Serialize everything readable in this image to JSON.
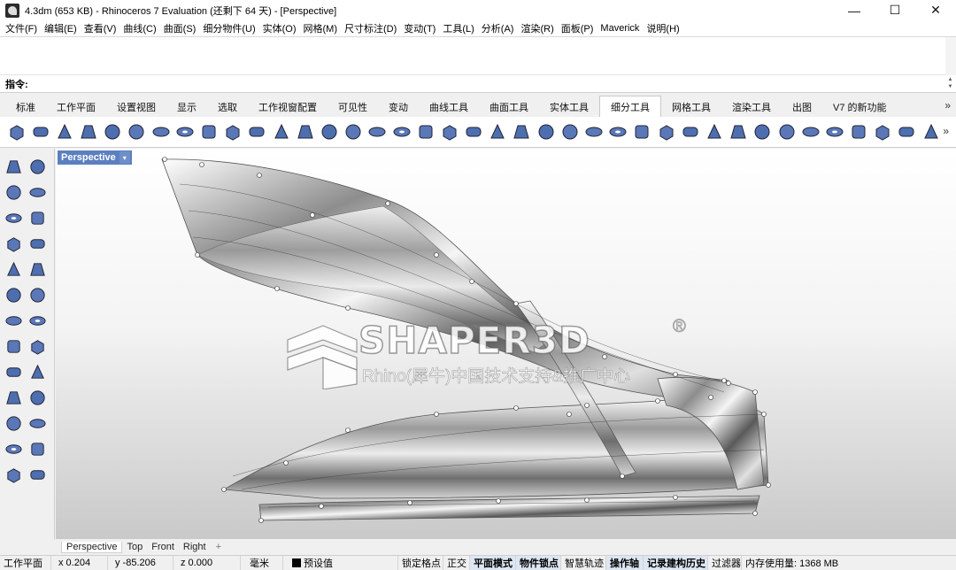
{
  "window": {
    "title": "4.3dm (653 KB) - Rhinoceros 7 Evaluation (还剩下 64 天) - [Perspective]",
    "minimize_glyph": "—",
    "maximize_glyph": "☐",
    "close_glyph": "✕"
  },
  "menu": [
    "文件(F)",
    "编辑(E)",
    "查看(V)",
    "曲线(C)",
    "曲面(S)",
    "细分物件(U)",
    "实体(O)",
    "网格(M)",
    "尺寸标注(D)",
    "变动(T)",
    "工具(L)",
    "分析(A)",
    "渲染(R)",
    "面板(P)",
    "Maverick",
    "说明(H)"
  ],
  "command": {
    "label": "指令:",
    "value": ""
  },
  "tabs": [
    "标准",
    "工作平面",
    "设置视图",
    "显示",
    "选取",
    "工作视窗配置",
    "可见性",
    "变动",
    "曲线工具",
    "曲面工具",
    "实体工具",
    "细分工具",
    "网格工具",
    "渲染工具",
    "出图",
    "V7 的新功能"
  ],
  "active_tab": "细分工具",
  "tabs_more": "»",
  "toolbar_icons": [
    "subd-box-icon",
    "subd-cylinder-icon",
    "subd-cone-icon",
    "subd-truncated-cone-icon",
    "subd-drum-icon",
    "subd-sphere-icon",
    "subd-ellipsoid-icon",
    "subd-torus-icon",
    "subd-cube-icon",
    "subd-multipipe-icon",
    "subd-1-2-icon",
    "subd-loft-icon",
    "subd-branch-icon",
    "subd-sweep1-icon",
    "subd-sweep2-icon",
    "subd-curve-network-icon",
    "subd-pipe-icon",
    "subd-extrude-icon",
    "subd-box-mode-icon",
    "subd-smooth-mode-icon",
    "subd-crease-icon",
    "subd-bridge-icon",
    "subd-fill-icon",
    "subd-insert-edge-icon",
    "subd-mesh-icon",
    "subd-reflect-icon",
    "subd-stitch-icon",
    "subd-weld-icon",
    "subd-slide-icon",
    "subd-split-icon",
    "subd-append-icon",
    "subd-offset-icon",
    "subd-thicken-icon",
    "subd-to-nurbs-icon",
    "subd-quadremesh-icon",
    "subd-display-toggle-icon",
    "subd-properties-icon",
    "subd-repair-icon",
    "subd-refresh-icon"
  ],
  "toolbar_label": "1 2",
  "viewport": {
    "name": "Perspective",
    "arrow": "▾"
  },
  "watermark": {
    "title": "SHAPER3D",
    "reg": "®",
    "subtitle": "Rhino(犀牛)中国技术支持&推广中心"
  },
  "viewport_tabs": [
    "Perspective",
    "Top",
    "Front",
    "Right"
  ],
  "viewport_tabs_add": "+",
  "status": {
    "cplane": "工作平面",
    "x": "x 0.204",
    "y": "y -85.206",
    "z": "z 0.000",
    "unit": "毫米",
    "layer": "预设值",
    "grid_snap": "锁定格点",
    "ortho": "正交",
    "planar": "平面模式",
    "osnap": "物件锁点",
    "smarttrack": "智慧轨迹",
    "gumball": "操作轴",
    "history": "记录建构历史",
    "filter": "过滤器",
    "memory": "内存使用量: 1368 MB"
  }
}
